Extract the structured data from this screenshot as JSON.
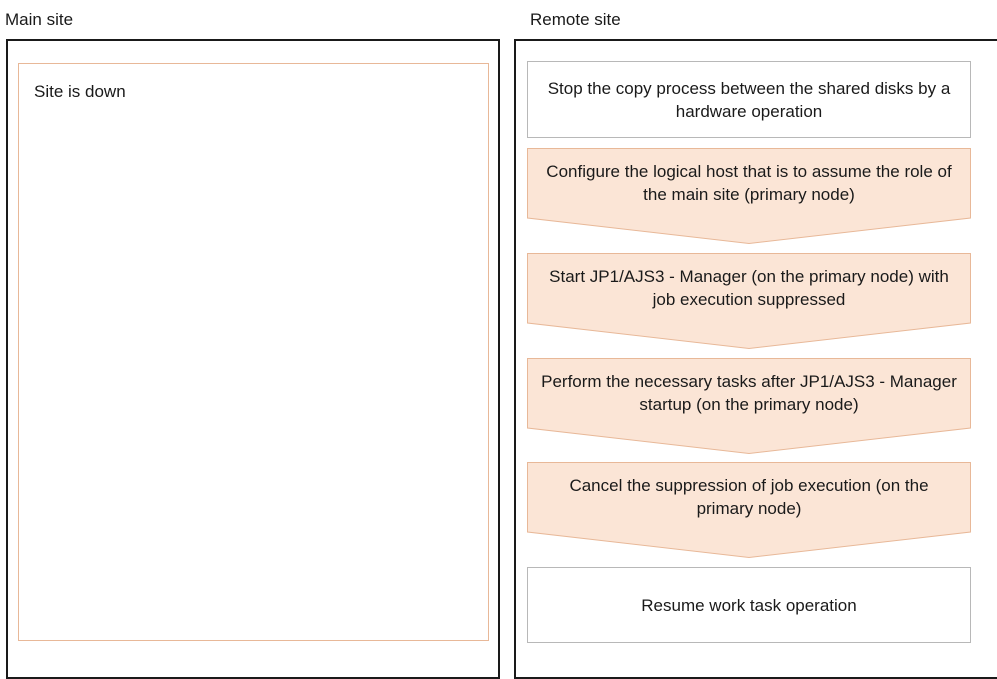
{
  "main_site": {
    "label": "Main site",
    "status": "Site is down"
  },
  "remote_site": {
    "label": "Remote site",
    "steps": [
      "Stop the copy process between the shared disks by a hardware operation",
      "Configure the logical host that is to assume the role of the main site (primary node)",
      "Start JP1/AJS3 - Manager (on the primary node) with job execution suppressed",
      "Perform the necessary tasks after JP1/AJS3 - Manager startup (on the primary node)",
      "Cancel the suppression of job execution (on the primary node)",
      "Resume work task operation"
    ]
  },
  "colors": {
    "step_fill": "#fbe5d6",
    "step_border": "#e8b898",
    "plain_border": "#b8b8b8",
    "panel_border": "#1a1a1a"
  }
}
